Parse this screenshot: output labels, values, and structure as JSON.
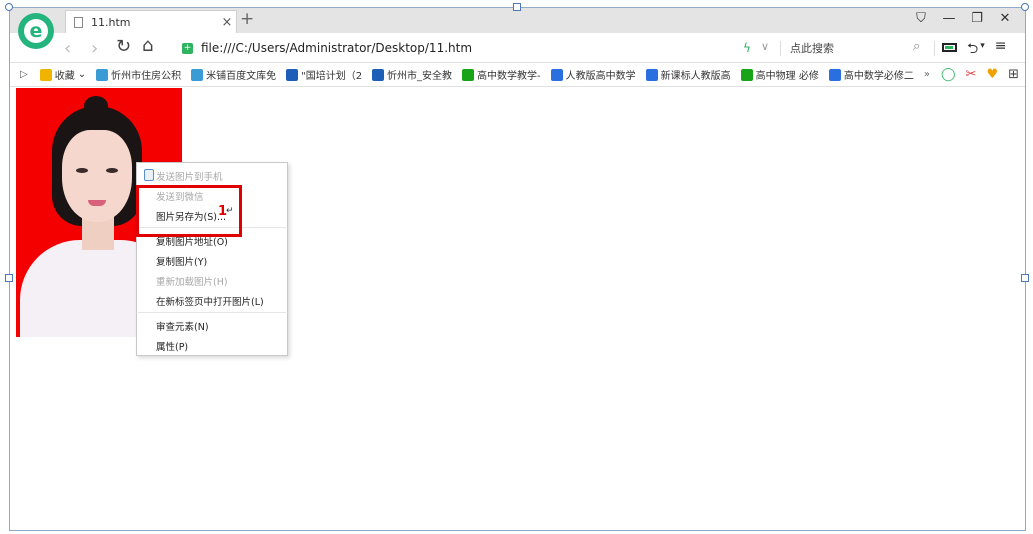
{
  "tab": {
    "title": "11.htm",
    "close": "×",
    "new_tab": "+"
  },
  "window": {
    "shirt_icon": "⛉",
    "minimize": "—",
    "restore": "❐",
    "close": "✕"
  },
  "nav": {
    "back": "‹",
    "forward": "›",
    "refresh": "↻",
    "home": "⌂"
  },
  "address": {
    "url": "file:///C:/Users/Administrator/Desktop/11.htm",
    "dropdown": "∨",
    "bolt": "ϟ"
  },
  "search": {
    "placeholder": "点此搜索",
    "icon": "⌕"
  },
  "toolbar_right": {
    "undo": "⮌",
    "undo_dd": "▾",
    "menu": "≡"
  },
  "bookmarks": {
    "toggle": "▷",
    "items": [
      {
        "label": "收藏",
        "color": "#f0b400",
        "suffix": "⌄"
      },
      {
        "label": "忻州市住房公积",
        "color": "#3a9bd5"
      },
      {
        "label": "米铺百度文库免",
        "color": "#3a9bd5"
      },
      {
        "label": "\"国培计划（2",
        "color": "#1c5fb8"
      },
      {
        "label": "忻州市_安全教",
        "color": "#1c5fb8"
      },
      {
        "label": "高中数学教学-",
        "color": "#18a318"
      },
      {
        "label": "人教版高中数学",
        "color": "#2a6fe0"
      },
      {
        "label": "新课标人教版高",
        "color": "#2a6fe0"
      },
      {
        "label": "高中物理 必修",
        "color": "#18a318"
      },
      {
        "label": "高中数学必修二",
        "color": "#2a6fe0"
      }
    ],
    "more": "»",
    "right_icons": [
      "◯",
      "✂",
      "♥",
      "⊞"
    ]
  },
  "context_menu": {
    "items": [
      {
        "label": "发送图片到手机",
        "disabled": true
      },
      {
        "label": "发送到微信",
        "disabled": true
      },
      {
        "label": "图片另存为(S)...",
        "disabled": false
      },
      {
        "label": "复制图片地址(O)",
        "disabled": false
      },
      {
        "label": "复制图片(Y)",
        "disabled": false
      },
      {
        "label": "重新加载图片(H)",
        "disabled": true
      },
      {
        "label": "在新标签页中打开图片(L)",
        "disabled": false
      },
      {
        "label": "审查元素(N)",
        "disabled": false
      },
      {
        "label": "属性(P)",
        "disabled": false
      }
    ]
  },
  "annotation": {
    "step": "1",
    "cursor": "↵"
  },
  "colors": {
    "accent_green": "#24b47e",
    "highlight_red": "#e00000",
    "photo_bg": "#f40000"
  }
}
